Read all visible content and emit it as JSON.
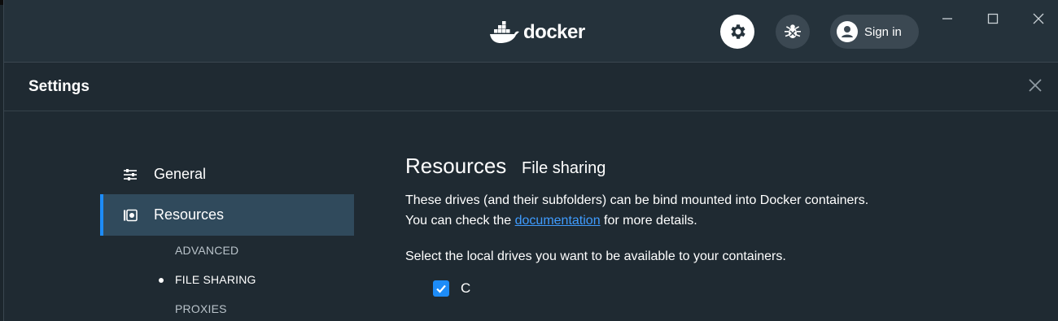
{
  "app": {
    "logo_text": "docker"
  },
  "header": {
    "signin_label": "Sign in"
  },
  "settings": {
    "title": "Settings"
  },
  "sidebar": {
    "items": [
      {
        "label": "General",
        "icon": "sliders-icon"
      },
      {
        "label": "Resources",
        "icon": "resources-icon",
        "selected": true
      }
    ],
    "subitems": [
      {
        "label": "ADVANCED"
      },
      {
        "label": "FILE SHARING",
        "selected": true
      },
      {
        "label": "PROXIES"
      }
    ]
  },
  "content": {
    "heading": "Resources",
    "subheading": "File sharing",
    "description_before_link": "These drives (and their subfolders) can be bind mounted into Docker containers. You can check the ",
    "link_text": "documentation",
    "description_after_link": " for more details.",
    "select_prompt": "Select the local drives you want to be available to your containers.",
    "drives": [
      {
        "label": "C",
        "checked": true
      }
    ]
  },
  "colors": {
    "accent": "#1d8cf8",
    "selected_nav_bg": "#304a5c",
    "link": "#3f9cff"
  }
}
